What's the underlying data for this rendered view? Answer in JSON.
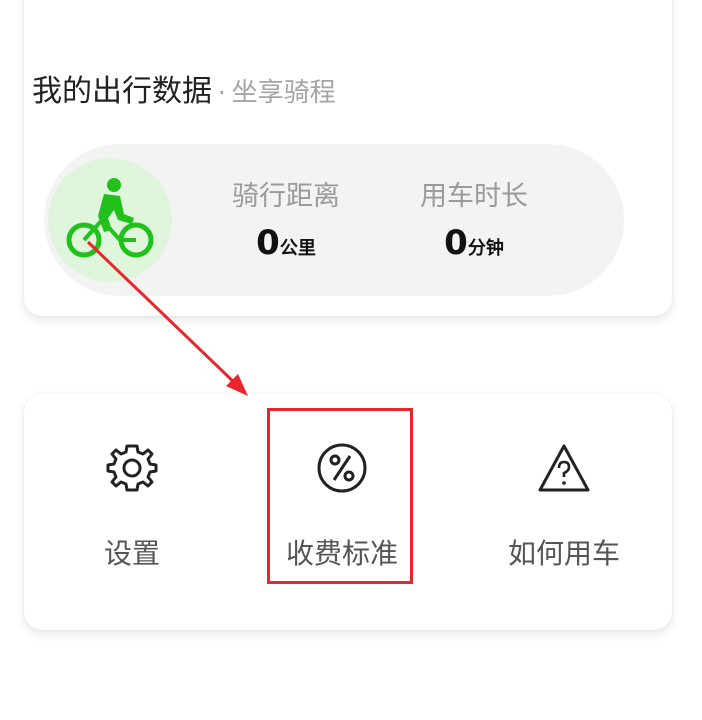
{
  "header": {
    "title": "我的出行数据",
    "separator": "·",
    "subtitle": "坐享骑程"
  },
  "stats": {
    "distance": {
      "label": "骑行距离",
      "value": "0",
      "unit": "公里"
    },
    "duration": {
      "label": "用车时长",
      "value": "0",
      "unit": "分钟"
    }
  },
  "bike_icon": {
    "name": "bike-rider-icon",
    "color": "#22c01a"
  },
  "menu": {
    "items": [
      {
        "label": "设置",
        "icon": "gear-icon"
      },
      {
        "label": "收费标准",
        "icon": "percent-icon"
      },
      {
        "label": "如何用车",
        "icon": "warning-triangle-icon"
      }
    ]
  },
  "annotation": {
    "color": "#e8262b"
  }
}
